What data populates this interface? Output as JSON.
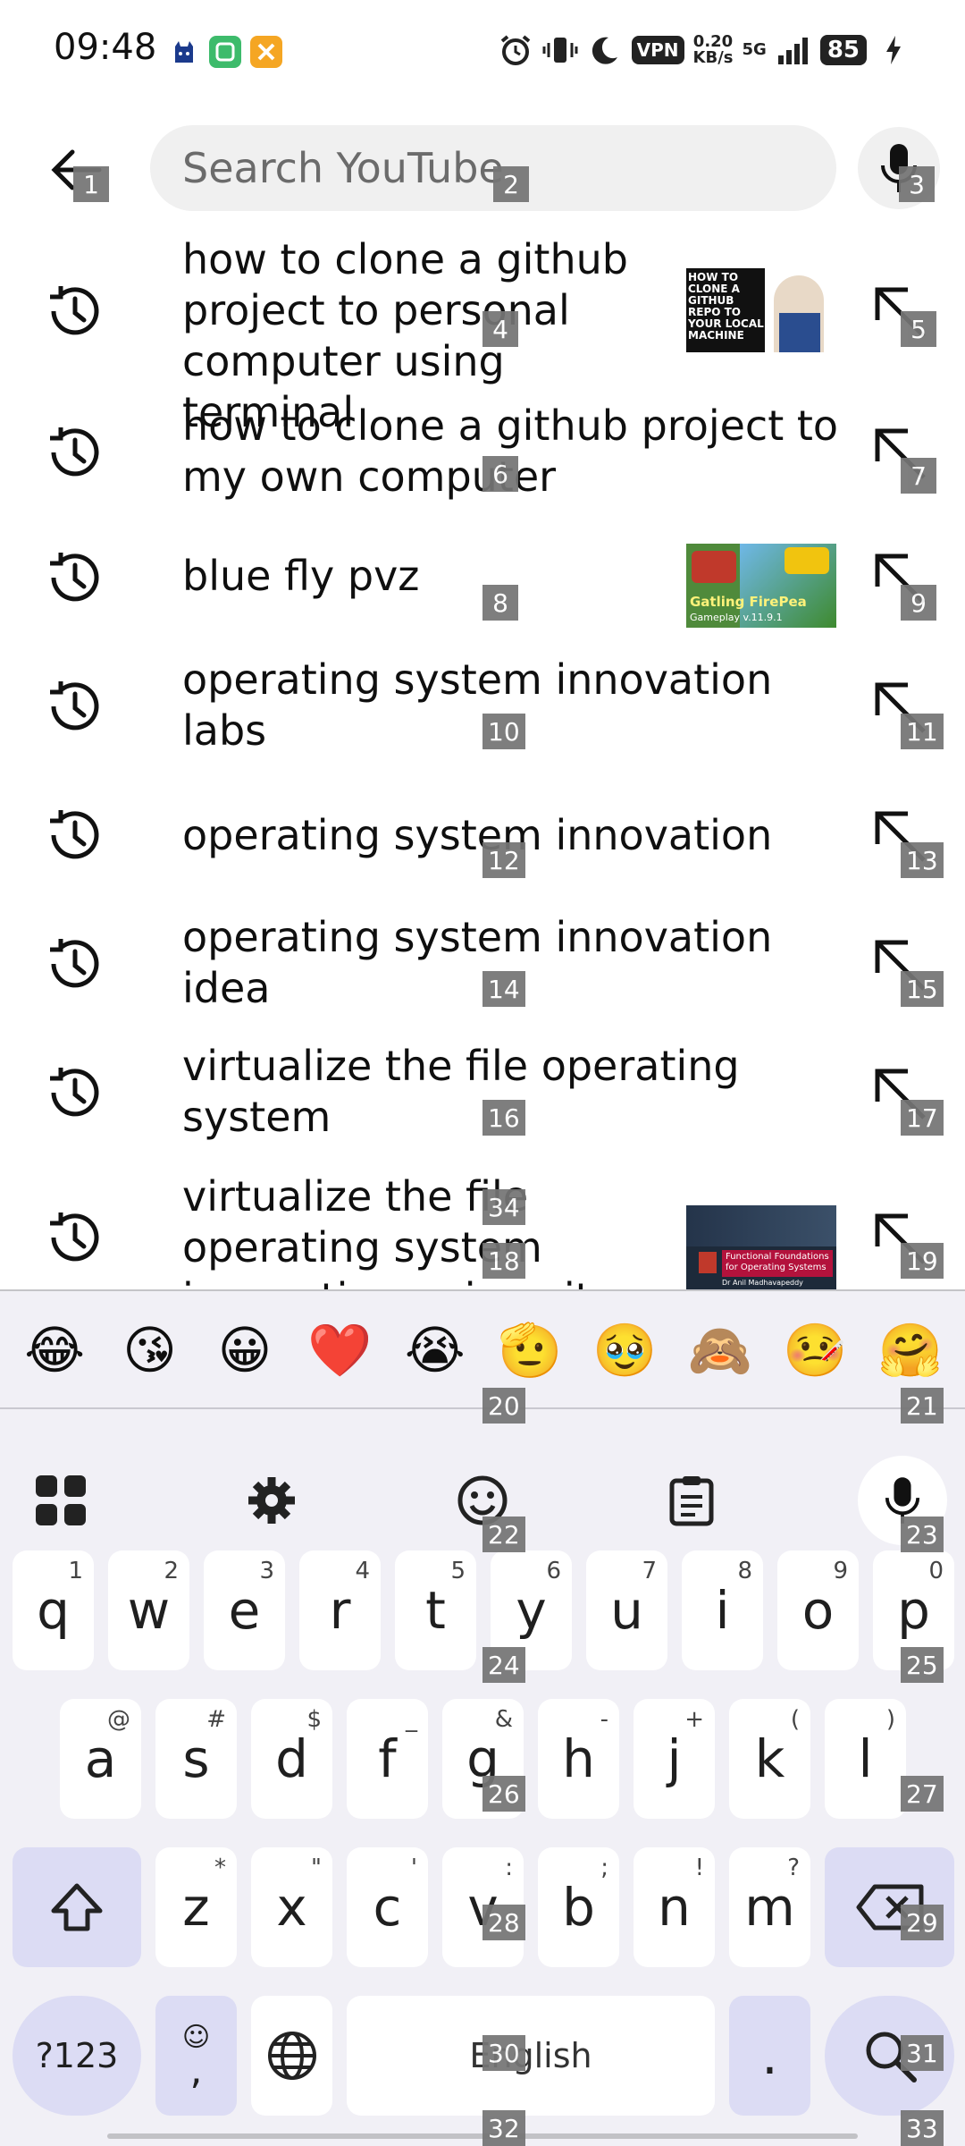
{
  "status_bar": {
    "time": "09:48",
    "vpn": "VPN",
    "speed_value": "0.20",
    "speed_unit": "KB/s",
    "network": "5G",
    "battery": "85"
  },
  "search": {
    "placeholder": "Search YouTube"
  },
  "suggestions": [
    {
      "text": "how to clone a github project to personal computer using terminal",
      "has_thumb": true,
      "thumb_caption": "HOW TO CLONE A GITHUB REPO TO YOUR LOCAL MACHINE"
    },
    {
      "text": "how to clone a github project to my own computer",
      "has_thumb": false
    },
    {
      "text": "blue fly pvz",
      "has_thumb": true,
      "thumb_caption": "Gatling FirePea",
      "thumb_caption2": "Gameplay v.11.9.1"
    },
    {
      "text": "operating system innovation labs",
      "has_thumb": false
    },
    {
      "text": "operating system innovation",
      "has_thumb": false
    },
    {
      "text": "operating system innovation idea",
      "has_thumb": false
    },
    {
      "text": "virtualize the file operating system",
      "has_thumb": false
    },
    {
      "text": "virtualize the file operating system innovation university lab",
      "has_thumb": true,
      "thumb_caption": "Functional Foundations for Operating Systems",
      "thumb_caption2": "Dr Anil Madhavapeddy"
    }
  ],
  "emojis": [
    "😂",
    "😘",
    "😀",
    "❤️",
    "😭",
    "🫡",
    "🥹",
    "🙈",
    "🤒",
    "🤗"
  ],
  "keyboard": {
    "row1": [
      {
        "key": "q",
        "hint": "1"
      },
      {
        "key": "w",
        "hint": "2"
      },
      {
        "key": "e",
        "hint": "3"
      },
      {
        "key": "r",
        "hint": "4"
      },
      {
        "key": "t",
        "hint": "5"
      },
      {
        "key": "y",
        "hint": "6"
      },
      {
        "key": "u",
        "hint": "7"
      },
      {
        "key": "i",
        "hint": "8"
      },
      {
        "key": "o",
        "hint": "9"
      },
      {
        "key": "p",
        "hint": "0"
      }
    ],
    "row2": [
      {
        "key": "a",
        "hint": "@"
      },
      {
        "key": "s",
        "hint": "#"
      },
      {
        "key": "d",
        "hint": "$"
      },
      {
        "key": "f",
        "hint": "_"
      },
      {
        "key": "g",
        "hint": "&"
      },
      {
        "key": "h",
        "hint": "-"
      },
      {
        "key": "j",
        "hint": "+"
      },
      {
        "key": "k",
        "hint": "("
      },
      {
        "key": "l",
        "hint": ")"
      }
    ],
    "row3": [
      {
        "key": "z",
        "hint": "*"
      },
      {
        "key": "x",
        "hint": "\""
      },
      {
        "key": "c",
        "hint": "'"
      },
      {
        "key": "v",
        "hint": ":"
      },
      {
        "key": "b",
        "hint": ";"
      },
      {
        "key": "n",
        "hint": "!"
      },
      {
        "key": "m",
        "hint": "?"
      }
    ],
    "symbols_label": "?123",
    "comma": ",",
    "space_label": "English",
    "period": "."
  },
  "badges": [
    "1",
    "2",
    "3",
    "4",
    "5",
    "6",
    "7",
    "8",
    "9",
    "10",
    "11",
    "12",
    "13",
    "14",
    "15",
    "16",
    "17",
    "18",
    "19",
    "20",
    "21",
    "22",
    "23",
    "24",
    "25",
    "26",
    "27",
    "28",
    "29",
    "30",
    "31",
    "32",
    "33",
    "34"
  ],
  "colors": {
    "search_bg": "#f0f0f0",
    "keyboard_bg": "#f1f0f6",
    "modifier_key": "#dcdcf4",
    "badge": "#757575"
  }
}
